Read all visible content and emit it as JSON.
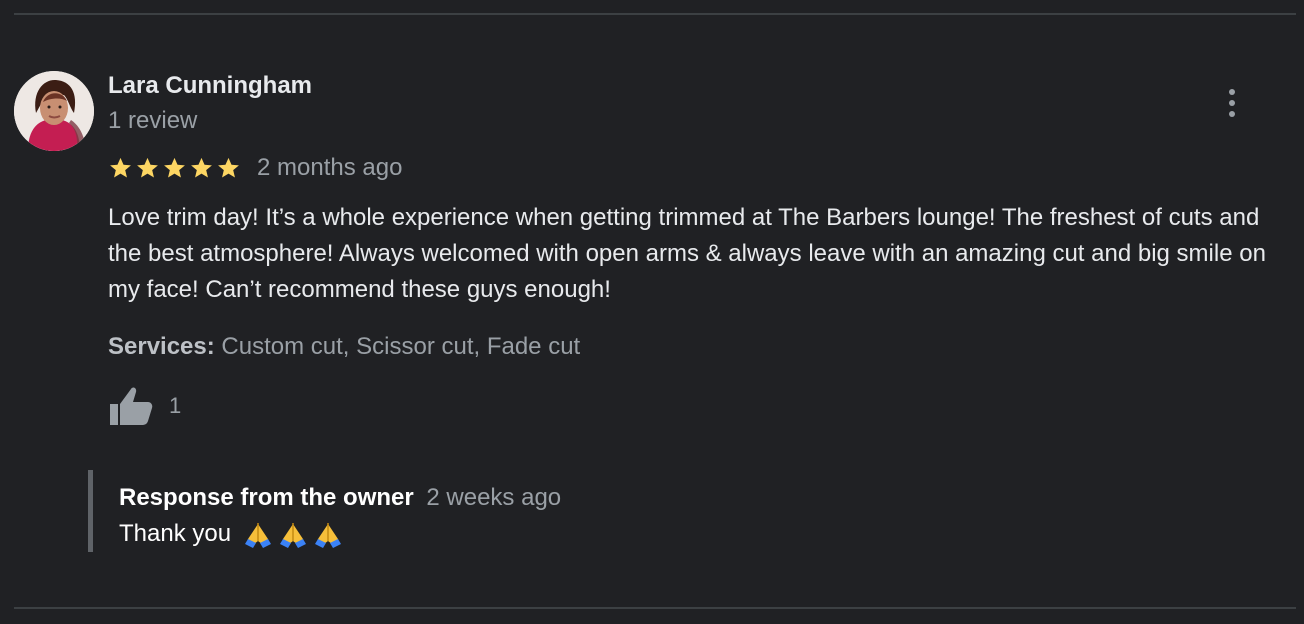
{
  "reviewer": {
    "name": "Lara Cunningham",
    "meta": "1 review"
  },
  "rating": {
    "stars": 5,
    "max_stars": 5,
    "age": "2 months ago",
    "star_color": "#fdd663"
  },
  "review": {
    "text": "Love trim day! It’s a whole experience when getting trimmed at The Barbers lounge! The freshest of cuts and the best atmosphere! Always welcomed with open arms & always leave with an amazing cut and big smile on my face! Can’t recommend these guys enough!"
  },
  "services": {
    "label": "Services:",
    "value": "Custom cut, Scissor cut, Fade cut"
  },
  "likes": {
    "count": "1",
    "icon": "thumbs-up-icon"
  },
  "owner_response": {
    "label": "Response from the owner",
    "age": "2 weeks ago",
    "text": "Thank you",
    "emoji_icons": [
      "folded-hands-icon",
      "folded-hands-icon",
      "folded-hands-icon"
    ]
  },
  "menu": {
    "icon": "more-vert-icon"
  },
  "colors": {
    "background": "#202124",
    "primary_text": "#e8eaed",
    "secondary_text": "#9aa0a6",
    "star": "#fdd663"
  }
}
